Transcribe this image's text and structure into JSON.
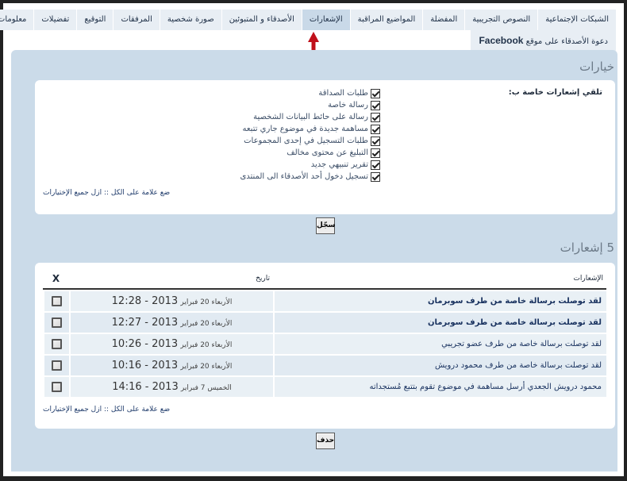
{
  "tabs": {
    "row1": [
      {
        "label": "معلومات",
        "active": false
      },
      {
        "label": "تفضيلات",
        "active": false
      },
      {
        "label": "التوقيع",
        "active": false
      },
      {
        "label": "المرفقات",
        "active": false
      },
      {
        "label": "صورة شخصية",
        "active": false
      },
      {
        "label": "الأصدقاء و المتبوئين",
        "active": false
      },
      {
        "label": "الإشعارات",
        "active": true
      },
      {
        "label": "المواضيع المراقبة",
        "active": false
      },
      {
        "label": "المفضلة",
        "active": false
      },
      {
        "label": "النصوص التجريبية",
        "active": false
      },
      {
        "label": "الشبكات الإجتماعية",
        "active": false
      }
    ],
    "row2": [
      {
        "label_prefix": "دعوة الأصدقاء على موقع",
        "label_brand": "Facebook"
      }
    ]
  },
  "options": {
    "title": "خيارات",
    "receive_label": "تلقي إشعارات خاصة ب:",
    "items": [
      {
        "label": "طلبات الصداقة",
        "checked": true
      },
      {
        "label": "رسالة خاصة",
        "checked": true
      },
      {
        "label": "رسالة على حائط البيانات الشخصية",
        "checked": true
      },
      {
        "label": "مساهمة جديدة في موضوع جاري تتبعه",
        "checked": true
      },
      {
        "label": "طلبات التسجيل في إحدى المجموعات",
        "checked": true
      },
      {
        "label": "التبليغ عن محتوى مخالف",
        "checked": true
      },
      {
        "label": "تقرير تنبيهي جديد",
        "checked": true
      },
      {
        "label": "تسجيل دخول أحد الأصدقاء الى المنتدى",
        "checked": true
      }
    ],
    "select_all": "ضع علامة على الكل",
    "separator": " :: ",
    "deselect_all": "ازل جميع الإختيارات",
    "save_label": "سجّل"
  },
  "notifications": {
    "title": "5 إشعارات",
    "columns": {
      "message": "الإشعارات",
      "date": "تاريخ",
      "select": "X"
    },
    "rows": [
      {
        "message": "لقد توصلت برسالة خاصة من طرف سوبرمان",
        "unread": true,
        "day": "الأربعاء 20 فبراير",
        "datetime": "2013 - 12:28",
        "checked": false
      },
      {
        "message": "لقد توصلت برسالة خاصة من طرف سوبرمان",
        "unread": true,
        "day": "الأربعاء 20 فبراير",
        "datetime": "2013 - 12:27",
        "checked": false
      },
      {
        "message": "لقد توصلت برسالة خاصة من طرف عضو تجريبي",
        "unread": false,
        "day": "الأربعاء 20 فبراير",
        "datetime": "2013 - 10:26",
        "checked": false
      },
      {
        "message": "لقد توصلت برسالة خاصة من طرف محمود درويش",
        "unread": false,
        "day": "الأربعاء 20 فبراير",
        "datetime": "2013 - 10:16",
        "checked": false
      },
      {
        "message": "محمود درويش الجعدي أرسل مساهمة في موضوع تقوم بتتبع مُستجداته",
        "unread": false,
        "day": "الخميس 7 فبراير",
        "datetime": "2013 - 14:16",
        "checked": false
      }
    ],
    "select_all": "ضع علامة على الكل",
    "separator": " :: ",
    "deselect_all": "ازل جميع الإختيارات",
    "delete_label": "حذف"
  },
  "colors": {
    "panel_bg": "#cbdbe9",
    "tab_bg": "#e8eef4",
    "tab_active_bg": "#c9d9e8",
    "arrow": "#c0101a",
    "link": "#1a3360"
  }
}
